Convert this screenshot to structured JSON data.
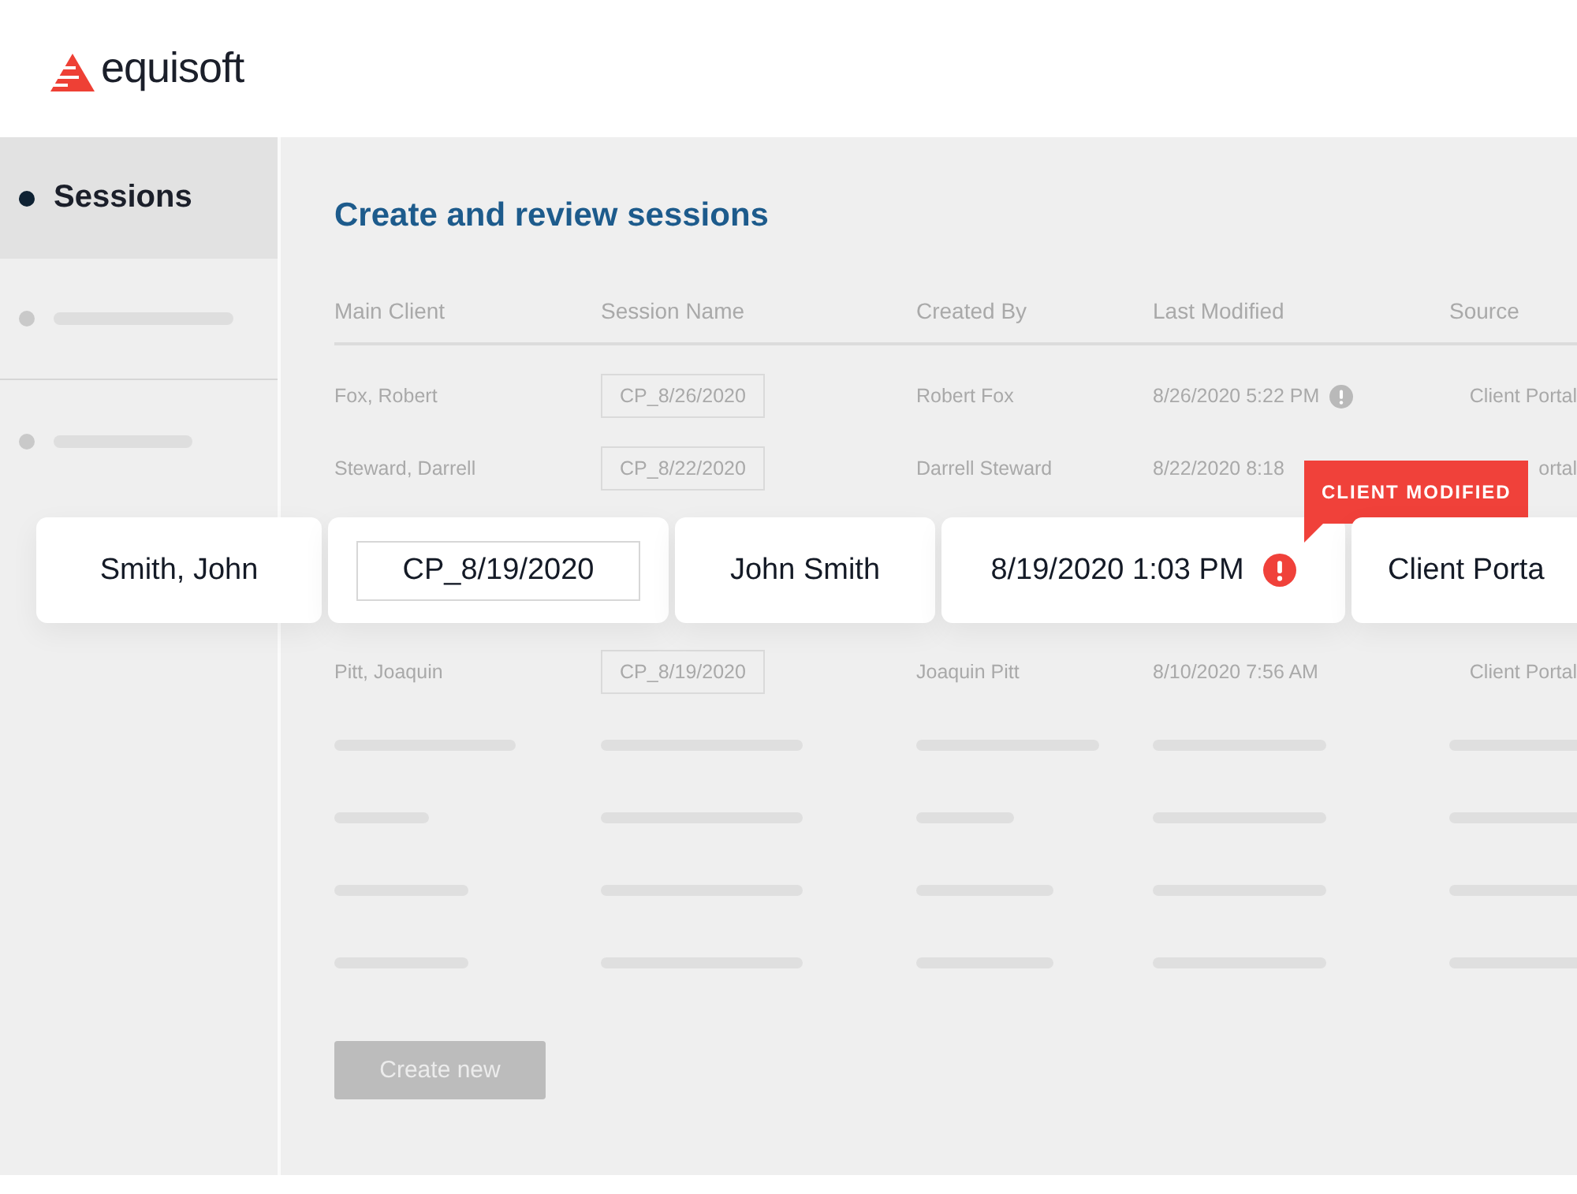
{
  "header": {
    "logo_text": "equisoft"
  },
  "sidebar": {
    "items": [
      {
        "kind": "label",
        "label": "Sessions",
        "selected": true
      },
      {
        "kind": "placeholder",
        "selected": false
      },
      {
        "kind": "placeholder",
        "selected": false
      }
    ]
  },
  "main": {
    "title": "Create and review sessions",
    "table": {
      "columns": [
        "Main Client",
        "Session Name",
        "Created By",
        "Last Modified",
        "Source"
      ],
      "rows": [
        {
          "kind": "data",
          "main_client": "Fox, Robert",
          "session_name": "CP_8/26/2020",
          "created_by": "Robert Fox",
          "last_modified": "8/26/2020 5:22 PM",
          "alert": true,
          "source": "Client Portal"
        },
        {
          "kind": "data",
          "main_client": "Steward, Darrell",
          "session_name": "CP_8/22/2020",
          "created_by": "Darrell Steward",
          "last_modified": "8/22/2020 8:18",
          "alert": false,
          "source": "ortal"
        },
        {
          "kind": "callout",
          "cells": [
            "Smith, John",
            "CP_8/19/2020",
            "John Smith",
            "8/19/2020 1:03 PM",
            "Client Porta"
          ],
          "alert": true,
          "tooltip": "CLIENT MODIFIED"
        },
        {
          "kind": "data",
          "main_client": "Pitt, Joaquin",
          "session_name": "CP_8/19/2020",
          "created_by": "Joaquin Pitt",
          "last_modified": "8/10/2020 7:56 AM",
          "alert": false,
          "source": "Client Portal"
        },
        {
          "kind": "placeholder"
        },
        {
          "kind": "placeholder"
        },
        {
          "kind": "placeholder"
        },
        {
          "kind": "placeholder"
        }
      ]
    },
    "button": {
      "label": "Create new",
      "disabled": true
    }
  }
}
